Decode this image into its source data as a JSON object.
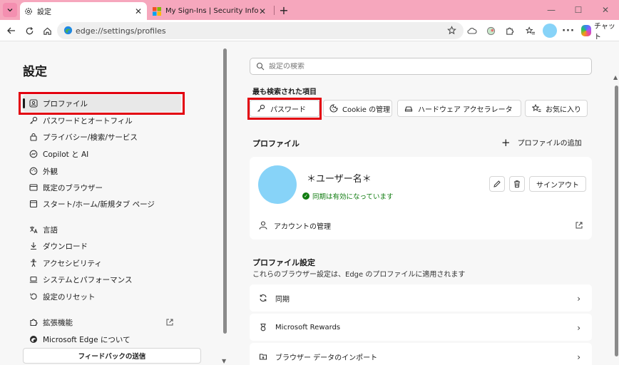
{
  "browser": {
    "tabs": [
      {
        "title": "設定",
        "active": true
      },
      {
        "title": "My Sign-Ins | Security Info | Microsoft",
        "active": false
      }
    ],
    "address": "edge://settings/profiles",
    "copilot_label": "チャット"
  },
  "sidebar": {
    "title": "設定",
    "items": [
      {
        "label": "プロファイル",
        "icon": "user-card-icon",
        "active": true
      },
      {
        "label": "パスワードとオートフィル",
        "icon": "key-icon"
      },
      {
        "label": "プライバシー/検索/サービス",
        "icon": "lock-icon"
      },
      {
        "label": "Copilot と AI",
        "icon": "copilot-icon"
      },
      {
        "label": "外観",
        "icon": "appearance-icon"
      },
      {
        "label": "既定のブラウザー",
        "icon": "browser-icon"
      },
      {
        "label": "スタート/ホーム/新規タブ ページ",
        "icon": "newtab-icon"
      },
      {
        "label": "言語",
        "icon": "language-icon"
      },
      {
        "label": "ダウンロード",
        "icon": "download-icon"
      },
      {
        "label": "アクセシビリティ",
        "icon": "accessibility-icon"
      },
      {
        "label": "システムとパフォーマンス",
        "icon": "laptop-icon"
      },
      {
        "label": "設定のリセット",
        "icon": "reset-icon"
      },
      {
        "label": "拡張機能",
        "icon": "extension-icon"
      },
      {
        "label": "Microsoft Edge について",
        "icon": "edge-icon"
      }
    ],
    "feedback_label": "フィードバックの送信"
  },
  "main": {
    "search_placeholder": "設定の検索",
    "most_searched_label": "最も検索された項目",
    "chips": [
      {
        "label": "パスワード",
        "icon": "key-icon"
      },
      {
        "label": "Cookie の管理",
        "icon": "cookie-icon"
      },
      {
        "label": "ハードウェア アクセラレータ",
        "icon": "hardware-icon"
      },
      {
        "label": "お気に入り",
        "icon": "favorites-star-icon"
      }
    ],
    "profiles": {
      "title": "プロファイル",
      "add_label": "プロファイルの追加",
      "user_name": "＊ユーザー名＊",
      "sync_status": "同期は有効になっています",
      "signout_label": "サインアウト",
      "account_label": "アカウントの管理"
    },
    "profile_settings": {
      "title": "プロファイル設定",
      "subtitle": "これらのブラウザー設定は、Edge のプロファイルに適用されます",
      "rows": [
        {
          "label": "同期",
          "icon": "sync-icon"
        },
        {
          "label": "Microsoft Rewards",
          "icon": "rewards-icon"
        },
        {
          "label": "ブラウザー データのインポート",
          "icon": "import-icon"
        }
      ]
    }
  },
  "colors": {
    "tabstrip": "#f6a7bd",
    "highlight": "#e3000f",
    "avatar": "#87d3f8",
    "sync_green": "#107c10"
  }
}
